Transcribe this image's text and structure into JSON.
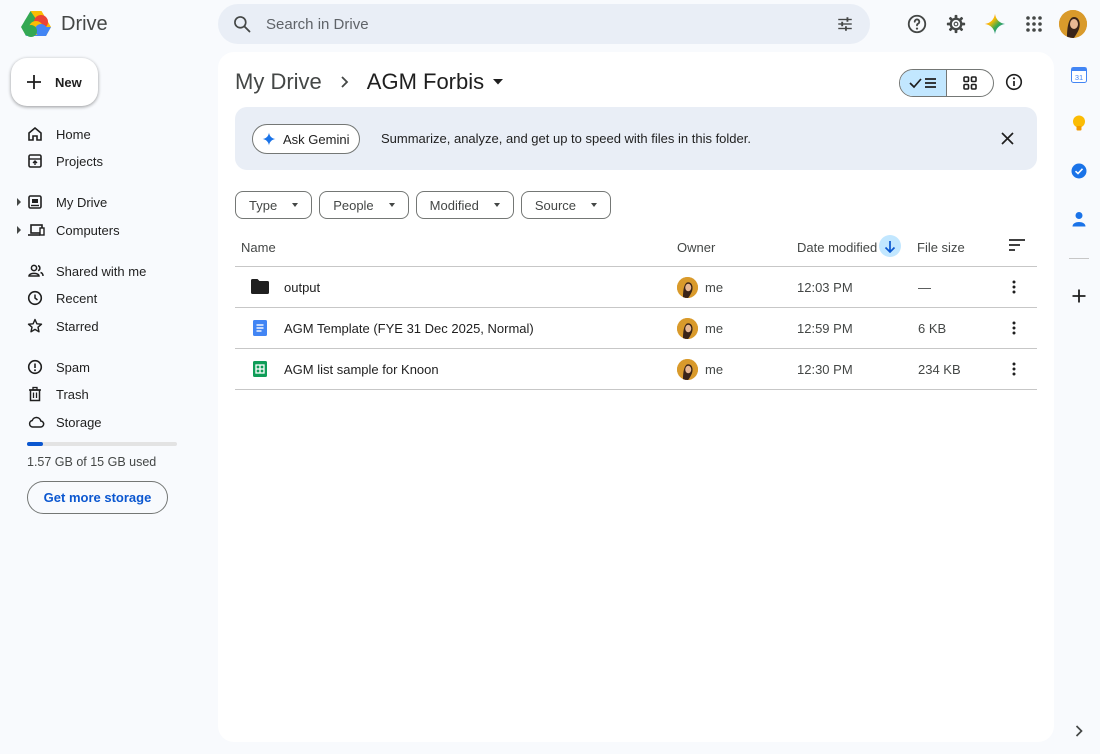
{
  "app": {
    "name": "Drive"
  },
  "search": {
    "placeholder": "Search in Drive"
  },
  "sidebar": {
    "new_label": "New",
    "items": [
      {
        "label": "Home"
      },
      {
        "label": "Projects"
      },
      {
        "label": "My Drive"
      },
      {
        "label": "Computers"
      },
      {
        "label": "Shared with me"
      },
      {
        "label": "Recent"
      },
      {
        "label": "Starred"
      },
      {
        "label": "Spam"
      },
      {
        "label": "Trash"
      },
      {
        "label": "Storage"
      }
    ],
    "storage": {
      "used_text": "1.57 GB of 15 GB used",
      "used_fraction": 0.105,
      "button_label": "Get more storage"
    }
  },
  "breadcrumb": {
    "root": "My Drive",
    "current": "AGM Forbis"
  },
  "gemini": {
    "button_label": "Ask Gemini",
    "message": "Summarize, analyze, and get up to speed with files in this folder."
  },
  "filters": [
    {
      "label": "Type"
    },
    {
      "label": "People"
    },
    {
      "label": "Modified"
    },
    {
      "label": "Source"
    }
  ],
  "table": {
    "headers": {
      "name": "Name",
      "owner": "Owner",
      "date_modified": "Date modified",
      "file_size": "File size"
    },
    "rows": [
      {
        "name": "output",
        "type": "folder",
        "owner": "me",
        "date": "12:03 PM",
        "size": "—"
      },
      {
        "name": "AGM Template (FYE 31 Dec 2025, Normal)",
        "type": "doc",
        "owner": "me",
        "date": "12:59 PM",
        "size": "6 KB"
      },
      {
        "name": "AGM list sample for Knoon",
        "type": "sheet",
        "owner": "me",
        "date": "12:30 PM",
        "size": "234 KB"
      }
    ]
  },
  "colors": {
    "accent": "#0b57d0",
    "selected": "#c2e7ff",
    "background": "#f8fafd"
  }
}
